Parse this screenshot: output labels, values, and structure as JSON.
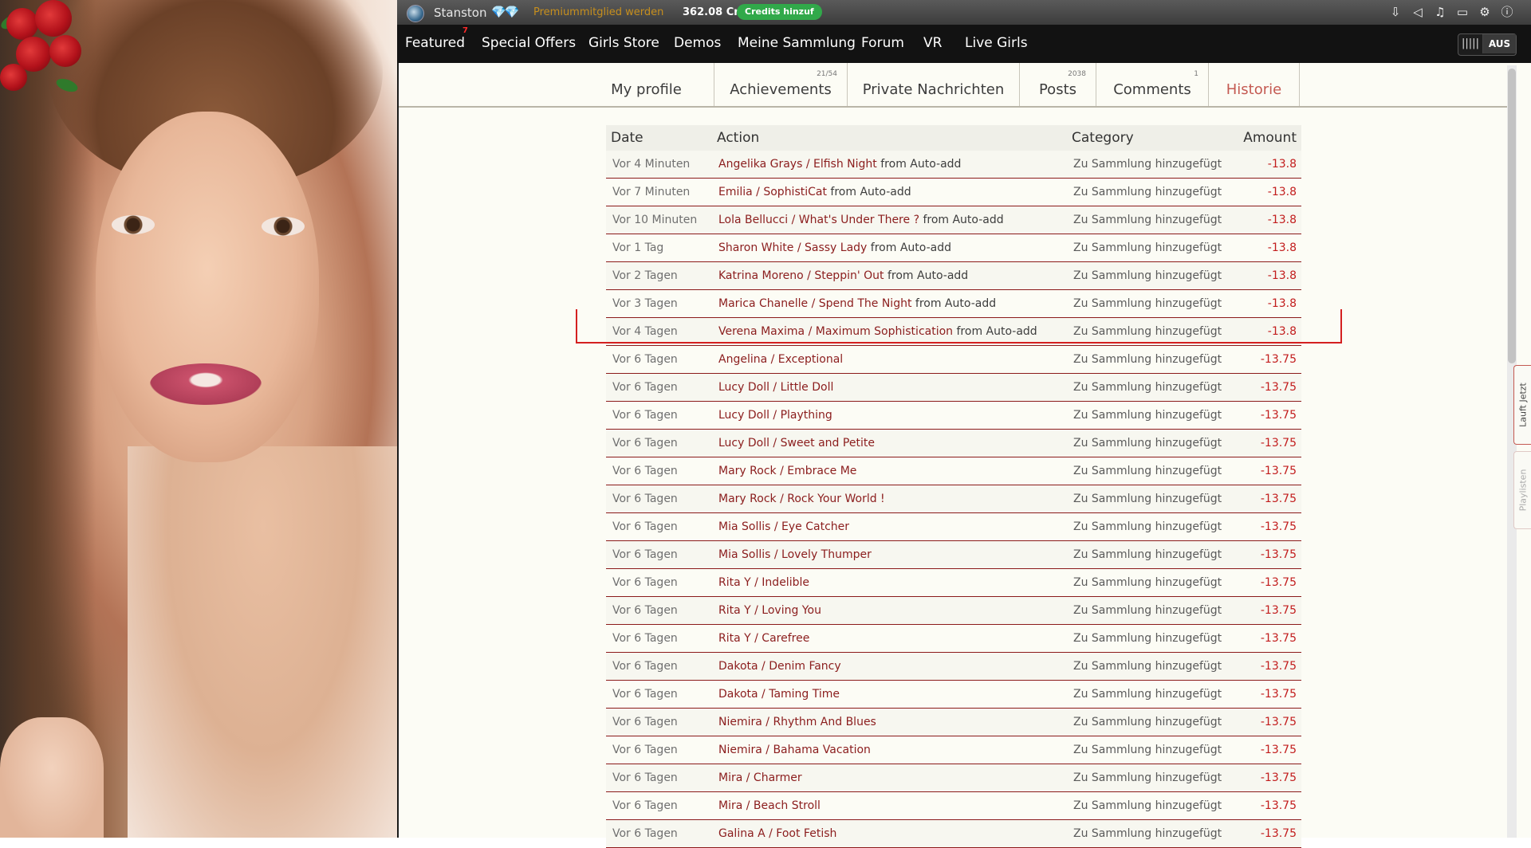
{
  "topbar": {
    "username": "Stanston",
    "gems": "💎💎",
    "premium_link": "Premiummitglied werden",
    "credits": "362.08 Cr",
    "add_credits": "Credits hinzuf"
  },
  "nav": {
    "items": [
      "Featured",
      "Special Offers",
      "Girls Store",
      "Demos",
      "Meine Sammlung",
      "Forum",
      "VR",
      "Live Girls"
    ],
    "featured_badge": "7",
    "toggle_label": "AUS"
  },
  "profile_tabs": [
    {
      "label": "My profile",
      "count": ""
    },
    {
      "label": "Achievements",
      "count": "21/54"
    },
    {
      "label": "Private Nachrichten",
      "count": ""
    },
    {
      "label": "Posts",
      "count": "2038"
    },
    {
      "label": "Comments",
      "count": "1"
    },
    {
      "label": "Historie",
      "count": ""
    }
  ],
  "table": {
    "headers": {
      "date": "Date",
      "action": "Action",
      "category": "Category",
      "amount": "Amount"
    },
    "rows": [
      {
        "date": "Vor 4 Minuten",
        "link": "Angelika Grays / Elfish Night",
        "suffix": " from Auto-add",
        "category": "Zu Sammlung hinzugefügt",
        "amount": "-13.8"
      },
      {
        "date": "Vor 7 Minuten",
        "link": "Emilia / SophistiCat",
        "suffix": " from Auto-add",
        "category": "Zu Sammlung hinzugefügt",
        "amount": "-13.8"
      },
      {
        "date": "Vor 10 Minuten",
        "link": "Lola Bellucci / What's Under There ?",
        "suffix": " from Auto-add",
        "category": "Zu Sammlung hinzugefügt",
        "amount": "-13.8"
      },
      {
        "date": "Vor 1 Tag",
        "link": "Sharon White / Sassy Lady",
        "suffix": " from Auto-add",
        "category": "Zu Sammlung hinzugefügt",
        "amount": "-13.8"
      },
      {
        "date": "Vor 2 Tagen",
        "link": "Katrina Moreno / Steppin' Out",
        "suffix": " from Auto-add",
        "category": "Zu Sammlung hinzugefügt",
        "amount": "-13.8"
      },
      {
        "date": "Vor 3 Tagen",
        "link": "Marica Chanelle / Spend The Night",
        "suffix": " from Auto-add",
        "category": "Zu Sammlung hinzugefügt",
        "amount": "-13.8"
      },
      {
        "date": "Vor 4 Tagen",
        "link": "Verena Maxima / Maximum Sophistication",
        "suffix": " from Auto-add",
        "category": "Zu Sammlung hinzugefügt",
        "amount": "-13.8"
      },
      {
        "date": "Vor 6 Tagen",
        "link": "Angelina / Exceptional",
        "suffix": "",
        "category": "Zu Sammlung hinzugefügt",
        "amount": "-13.75"
      },
      {
        "date": "Vor 6 Tagen",
        "link": "Lucy Doll / Little Doll",
        "suffix": "",
        "category": "Zu Sammlung hinzugefügt",
        "amount": "-13.75"
      },
      {
        "date": "Vor 6 Tagen",
        "link": "Lucy Doll / Plaything",
        "suffix": "",
        "category": "Zu Sammlung hinzugefügt",
        "amount": "-13.75"
      },
      {
        "date": "Vor 6 Tagen",
        "link": "Lucy Doll / Sweet and Petite",
        "suffix": "",
        "category": "Zu Sammlung hinzugefügt",
        "amount": "-13.75"
      },
      {
        "date": "Vor 6 Tagen",
        "link": "Mary Rock / Embrace Me",
        "suffix": "",
        "category": "Zu Sammlung hinzugefügt",
        "amount": "-13.75"
      },
      {
        "date": "Vor 6 Tagen",
        "link": "Mary Rock / Rock Your World !",
        "suffix": "",
        "category": "Zu Sammlung hinzugefügt",
        "amount": "-13.75"
      },
      {
        "date": "Vor 6 Tagen",
        "link": "Mia Sollis / Eye Catcher",
        "suffix": "",
        "category": "Zu Sammlung hinzugefügt",
        "amount": "-13.75"
      },
      {
        "date": "Vor 6 Tagen",
        "link": "Mia Sollis / Lovely Thumper",
        "suffix": "",
        "category": "Zu Sammlung hinzugefügt",
        "amount": "-13.75"
      },
      {
        "date": "Vor 6 Tagen",
        "link": "Rita Y / Indelible",
        "suffix": "",
        "category": "Zu Sammlung hinzugefügt",
        "amount": "-13.75"
      },
      {
        "date": "Vor 6 Tagen",
        "link": "Rita Y / Loving You",
        "suffix": "",
        "category": "Zu Sammlung hinzugefügt",
        "amount": "-13.75"
      },
      {
        "date": "Vor 6 Tagen",
        "link": "Rita Y / Carefree",
        "suffix": "",
        "category": "Zu Sammlung hinzugefügt",
        "amount": "-13.75"
      },
      {
        "date": "Vor 6 Tagen",
        "link": "Dakota / Denim Fancy",
        "suffix": "",
        "category": "Zu Sammlung hinzugefügt",
        "amount": "-13.75"
      },
      {
        "date": "Vor 6 Tagen",
        "link": "Dakota / Taming Time",
        "suffix": "",
        "category": "Zu Sammlung hinzugefügt",
        "amount": "-13.75"
      },
      {
        "date": "Vor 6 Tagen",
        "link": "Niemira / Rhythm And Blues",
        "suffix": "",
        "category": "Zu Sammlung hinzugefügt",
        "amount": "-13.75"
      },
      {
        "date": "Vor 6 Tagen",
        "link": "Niemira / Bahama Vacation",
        "suffix": "",
        "category": "Zu Sammlung hinzugefügt",
        "amount": "-13.75"
      },
      {
        "date": "Vor 6 Tagen",
        "link": "Mira / Charmer",
        "suffix": "",
        "category": "Zu Sammlung hinzugefügt",
        "amount": "-13.75"
      },
      {
        "date": "Vor 6 Tagen",
        "link": "Mira / Beach Stroll",
        "suffix": "",
        "category": "Zu Sammlung hinzugefügt",
        "amount": "-13.75"
      },
      {
        "date": "Vor 6 Tagen",
        "link": "Galina A / Foot Fetish",
        "suffix": "",
        "category": "Zu Sammlung hinzugefügt",
        "amount": "-13.75"
      }
    ]
  },
  "side_tabs": {
    "now_playing": "Lauft Jetzt",
    "playlists": "Playlisten"
  },
  "icons": [
    "download-icon",
    "speaker-icon",
    "music-icon",
    "monitor-icon",
    "settings-icon",
    "info-icon"
  ],
  "colors": {
    "accent": "#c45a52",
    "link": "#8b1d1d",
    "amount": "#c21d1d",
    "highlight": "#d42020",
    "credits_button": "#31a94a"
  }
}
